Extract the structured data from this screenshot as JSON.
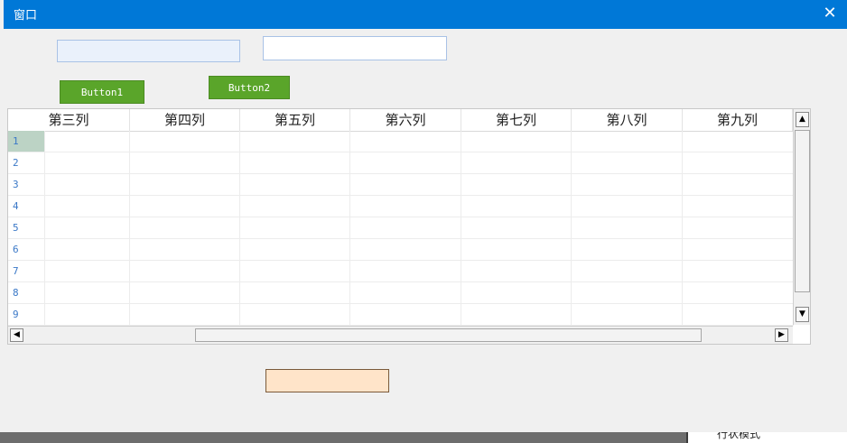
{
  "window": {
    "title": "窗口",
    "close_glyph": "✕"
  },
  "buttons": {
    "button1": "Button1",
    "button2": "Button2"
  },
  "grid": {
    "columns": [
      "第三列",
      "第四列",
      "第五列",
      "第六列",
      "第七列",
      "第八列",
      "第九列"
    ],
    "row_numbers": [
      "1",
      "2",
      "3",
      "4",
      "5",
      "6",
      "7",
      "8",
      "9"
    ],
    "selected_row": "1"
  },
  "scrollbar_glyphs": {
    "up": "▲",
    "down": "▼",
    "left": "◀",
    "right": "▶"
  },
  "background_window": {
    "text": "行状模式"
  },
  "colors": {
    "titlebar": "#0078d7",
    "button": "#5aa52a",
    "orange_box": "#ffe4c9"
  }
}
